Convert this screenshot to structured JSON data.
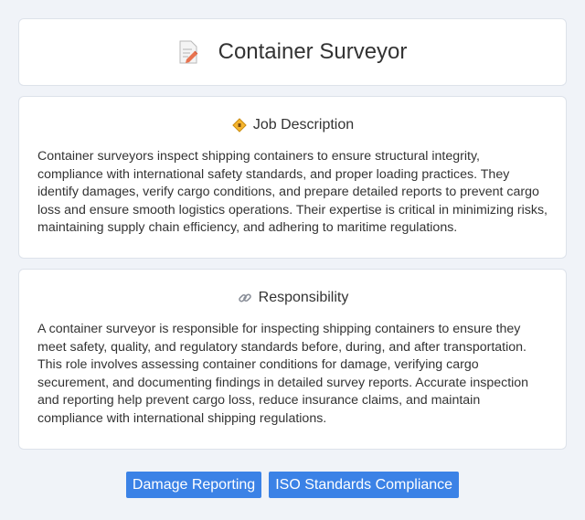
{
  "header": {
    "title": "Container Surveyor",
    "icon": "memo-pencil-icon"
  },
  "job_description": {
    "heading": "Job Description",
    "icon": "diamond-sign-icon",
    "text": "Container surveyors inspect shipping containers to ensure structural integrity, compliance with international safety standards, and proper loading practices. They identify damages, verify cargo conditions, and prepare detailed reports to prevent cargo loss and ensure smooth logistics operations. Their expertise is critical in minimizing risks, maintaining supply chain efficiency, and adhering to maritime regulations."
  },
  "responsibility": {
    "heading": "Responsibility",
    "icon": "link-icon",
    "text": "A container surveyor is responsible for inspecting shipping containers to ensure they meet safety, quality, and regulatory standards before, during, and after transportation. This role involves assessing container conditions for damage, verifying cargo securement, and documenting findings in detailed survey reports. Accurate inspection and reporting help prevent cargo loss, reduce insurance claims, and maintain compliance with international shipping regulations."
  },
  "tags": [
    "Damage Reporting",
    "ISO Standards Compliance"
  ],
  "colors": {
    "tag_background": "#3b82e6",
    "page_background": "#f0f3f8"
  }
}
